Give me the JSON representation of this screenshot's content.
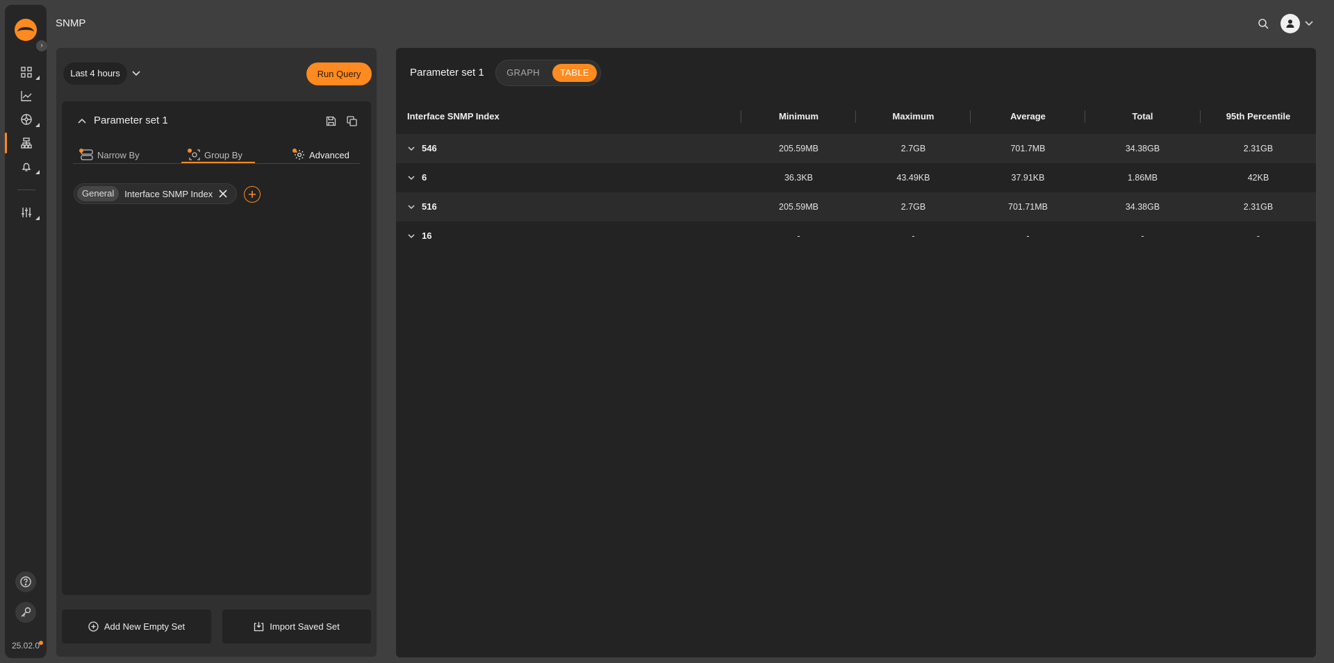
{
  "app": {
    "title": "SNMP",
    "version": "25.02.0"
  },
  "sidebar": {
    "items": [
      {
        "name": "dashboards-icon"
      },
      {
        "name": "analytics-chart-icon"
      },
      {
        "name": "network-devices-icon"
      },
      {
        "name": "flows-sitemap-icon",
        "active": true
      },
      {
        "name": "alerts-bell-icon"
      },
      {
        "name": "settings-sliders-icon"
      }
    ],
    "bottom": [
      {
        "name": "help-icon"
      },
      {
        "name": "key-icon"
      }
    ]
  },
  "query": {
    "time_range": "Last 4 hours",
    "run_label": "Run Query",
    "parameter_set_title": "Parameter set 1",
    "tabs": [
      {
        "label": "Narrow By"
      },
      {
        "label": "Group By",
        "active": true
      },
      {
        "label": "Advanced"
      }
    ],
    "group_chip": {
      "category": "General",
      "value": "Interface SNMP Index"
    },
    "add_empty_label": "Add New Empty Set",
    "import_label": "Import Saved Set"
  },
  "results": {
    "title": "Parameter set 1",
    "view_toggle": {
      "graph": "GRAPH",
      "table": "TABLE",
      "active": "TABLE"
    },
    "columns": [
      "Interface SNMP Index",
      "Minimum",
      "Maximum",
      "Average",
      "Total",
      "95th Percentile"
    ],
    "rows": [
      {
        "index": "546",
        "minimum": "205.59MB",
        "maximum": "2.7GB",
        "average": "701.7MB",
        "total": "34.38GB",
        "p95": "2.31GB"
      },
      {
        "index": "6",
        "minimum": "36.3KB",
        "maximum": "43.49KB",
        "average": "37.91KB",
        "total": "1.86MB",
        "p95": "42KB"
      },
      {
        "index": "516",
        "minimum": "205.59MB",
        "maximum": "2.7GB",
        "average": "701.71MB",
        "total": "34.38GB",
        "p95": "2.31GB"
      },
      {
        "index": "16",
        "minimum": "-",
        "maximum": "-",
        "average": "-",
        "total": "-",
        "p95": "-"
      }
    ]
  },
  "colors": {
    "accent": "#ff8a1f",
    "panel": "#232323",
    "background": "#3f3f3f"
  }
}
